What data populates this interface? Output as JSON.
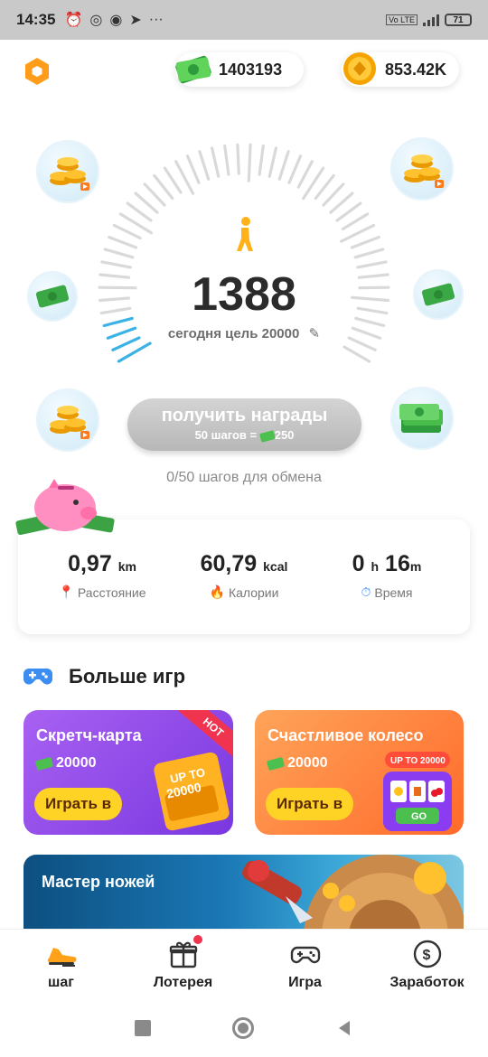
{
  "status_bar": {
    "time": "14:35",
    "battery": "71"
  },
  "header": {
    "cash_value": "1403193",
    "coin_value": "853.42K"
  },
  "steps": {
    "count": "1388",
    "goal_text": "сегодня цель 20000",
    "reward_button": "получить награды",
    "reward_sub": "50 шагов =",
    "reward_amount": "250",
    "exchange_text": "0/50 шагов для обмена"
  },
  "stats": {
    "distance_value": "0,97",
    "distance_unit": "km",
    "distance_label": "Расстояние",
    "calories_value": "60,79",
    "calories_unit": "kcal",
    "calories_label": "Калории",
    "time_hours": "0",
    "time_h_unit": "h",
    "time_minutes": "16",
    "time_m_unit": "m",
    "time_label": "Время"
  },
  "more_games": {
    "title": "Больше игр",
    "scratch": {
      "title": "Скретч-карта",
      "amount": "20000",
      "play": "Играть в",
      "badge": "HOT",
      "art_line1": "UP TO",
      "art_line2": "20000"
    },
    "wheel": {
      "title": "Счастливое колесо",
      "amount": "20000",
      "play": "Играть в",
      "art_text": "UP TO 20000",
      "go": "GO"
    },
    "knife": {
      "title": "Мастер ножей"
    }
  },
  "nav": {
    "tabs": [
      {
        "label": "шаг"
      },
      {
        "label": "Лотерея"
      },
      {
        "label": "Игра"
      },
      {
        "label": "Заработок"
      }
    ]
  },
  "colors": {
    "accent_orange": "#ff9d1b",
    "progress_blue": "#3ab2e6",
    "purple_card": "#8b45e8",
    "orange_card": "#ff7a34"
  }
}
